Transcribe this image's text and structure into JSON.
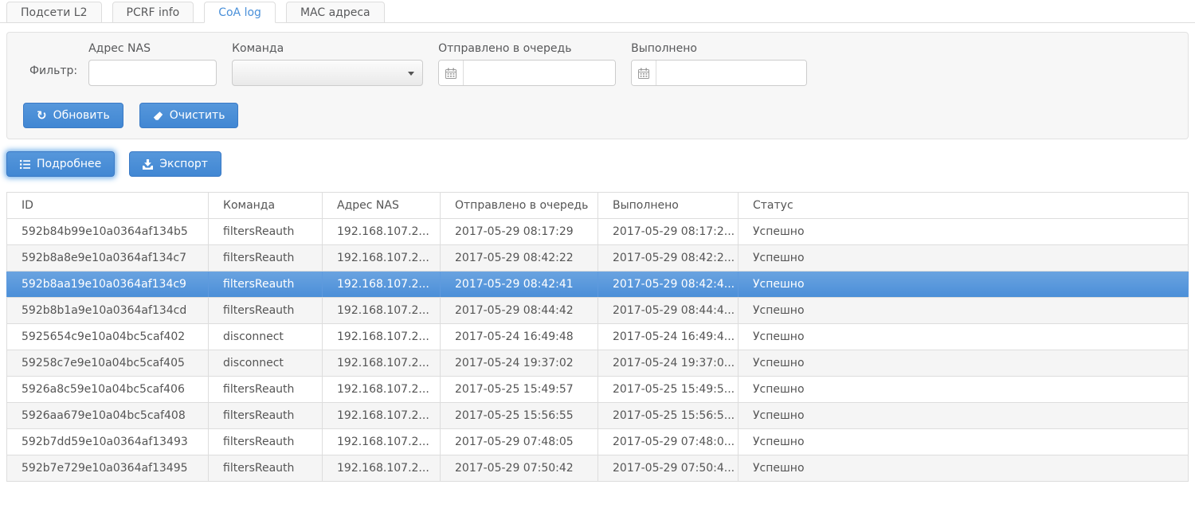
{
  "tabs": [
    {
      "label": "Подсети L2",
      "active": false
    },
    {
      "label": "PCRF info",
      "active": false
    },
    {
      "label": "CoA log",
      "active": true
    },
    {
      "label": "MAC адреса",
      "active": false
    }
  ],
  "filter": {
    "caption": "Фильтр:",
    "nas": {
      "label": "Адрес NAS",
      "value": ""
    },
    "command": {
      "label": "Команда",
      "value": ""
    },
    "queued": {
      "label": "Отправлено в очередь",
      "value": ""
    },
    "executed": {
      "label": "Выполнено",
      "value": ""
    },
    "refresh_label": "Обновить",
    "clear_label": "Очистить"
  },
  "actions": {
    "details_label": "Подробнее",
    "export_label": "Экспорт"
  },
  "table": {
    "columns": [
      "ID",
      "Команда",
      "Адрес NAS",
      "Отправлено в очередь",
      "Выполнено",
      "Статус"
    ],
    "rows": [
      {
        "id": "592b84b99e10a0364af134b5",
        "command": "filtersReauth",
        "nas": "192.168.107.2...",
        "queued": "2017-05-29 08:17:29",
        "executed": "2017-05-29 08:17:2...",
        "status": "Успешно",
        "selected": false
      },
      {
        "id": "592b8a8e9e10a0364af134c7",
        "command": "filtersReauth",
        "nas": "192.168.107.2...",
        "queued": "2017-05-29 08:42:22",
        "executed": "2017-05-29 08:42:2...",
        "status": "Успешно",
        "selected": false
      },
      {
        "id": "592b8aa19e10a0364af134c9",
        "command": "filtersReauth",
        "nas": "192.168.107.2...",
        "queued": "2017-05-29 08:42:41",
        "executed": "2017-05-29 08:42:4...",
        "status": "Успешно",
        "selected": true
      },
      {
        "id": "592b8b1a9e10a0364af134cd",
        "command": "filtersReauth",
        "nas": "192.168.107.2...",
        "queued": "2017-05-29 08:44:42",
        "executed": "2017-05-29 08:44:4...",
        "status": "Успешно",
        "selected": false
      },
      {
        "id": "5925654c9e10a04bc5caf402",
        "command": "disconnect",
        "nas": "192.168.107.2...",
        "queued": "2017-05-24 16:49:48",
        "executed": "2017-05-24 16:49:4...",
        "status": "Успешно",
        "selected": false
      },
      {
        "id": "59258c7e9e10a04bc5caf405",
        "command": "disconnect",
        "nas": "192.168.107.2...",
        "queued": "2017-05-24 19:37:02",
        "executed": "2017-05-24 19:37:0...",
        "status": "Успешно",
        "selected": false
      },
      {
        "id": "5926a8c59e10a04bc5caf406",
        "command": "filtersReauth",
        "nas": "192.168.107.2...",
        "queued": "2017-05-25 15:49:57",
        "executed": "2017-05-25 15:49:5...",
        "status": "Успешно",
        "selected": false
      },
      {
        "id": "5926aa679e10a04bc5caf408",
        "command": "filtersReauth",
        "nas": "192.168.107.2...",
        "queued": "2017-05-25 15:56:55",
        "executed": "2017-05-25 15:56:5...",
        "status": "Успешно",
        "selected": false
      },
      {
        "id": "592b7dd59e10a0364af13493",
        "command": "filtersReauth",
        "nas": "192.168.107.2...",
        "queued": "2017-05-29 07:48:05",
        "executed": "2017-05-29 07:48:0...",
        "status": "Успешно",
        "selected": false
      },
      {
        "id": "592b7e729e10a0364af13495",
        "command": "filtersReauth",
        "nas": "192.168.107.2...",
        "queued": "2017-05-29 07:50:42",
        "executed": "2017-05-29 07:50:4...",
        "status": "Успешно",
        "selected": false
      }
    ]
  },
  "icons": {
    "refresh": "↻"
  },
  "colors": {
    "accent": "#4a90d9",
    "selected_row": "#4a8ed8",
    "stripe": "#f5f5f5",
    "border": "#dddddd",
    "panel_bg": "#f7f7f7"
  }
}
